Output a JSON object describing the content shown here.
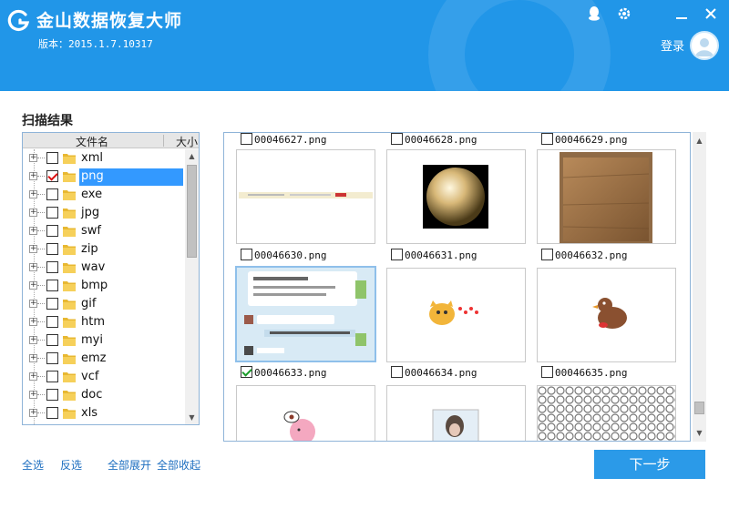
{
  "app": {
    "title": "金山数据恢复大师",
    "version": "版本：2015.1.7.10317",
    "login": "登录",
    "icons": [
      "qq-icon",
      "gear-icon",
      "minimize-icon",
      "close-icon"
    ],
    "accent_color": "#2196e8"
  },
  "scan": {
    "title": "扫描结果",
    "columns": {
      "name": "文件名",
      "size": "大小"
    },
    "items": [
      {
        "label": "xml",
        "checked": false,
        "selected": false
      },
      {
        "label": "png",
        "checked": true,
        "selected": true
      },
      {
        "label": "exe",
        "checked": false,
        "selected": false
      },
      {
        "label": "jpg",
        "checked": false,
        "selected": false
      },
      {
        "label": "swf",
        "checked": false,
        "selected": false
      },
      {
        "label": "zip",
        "checked": false,
        "selected": false
      },
      {
        "label": "wav",
        "checked": false,
        "selected": false
      },
      {
        "label": "bmp",
        "checked": false,
        "selected": false
      },
      {
        "label": "gif",
        "checked": false,
        "selected": false
      },
      {
        "label": "htm",
        "checked": false,
        "selected": false
      },
      {
        "label": "myi",
        "checked": false,
        "selected": false
      },
      {
        "label": "emz",
        "checked": false,
        "selected": false
      },
      {
        "label": "vcf",
        "checked": false,
        "selected": false
      },
      {
        "label": "doc",
        "checked": false,
        "selected": false
      },
      {
        "label": "xls",
        "checked": false,
        "selected": false
      }
    ]
  },
  "files": [
    {
      "name": "00046627.png",
      "checked": false,
      "kind": "caption-only"
    },
    {
      "name": "00046628.png",
      "checked": false,
      "kind": "caption-only"
    },
    {
      "name": "00046629.png",
      "checked": false,
      "kind": "caption-only"
    },
    {
      "name": "00046630.png",
      "checked": false,
      "kind": "banner"
    },
    {
      "name": "00046631.png",
      "checked": false,
      "kind": "sphere"
    },
    {
      "name": "00046632.png",
      "checked": false,
      "kind": "wood-cube"
    },
    {
      "name": "00046633.png",
      "checked": true,
      "kind": "chat-screenshot"
    },
    {
      "name": "00046634.png",
      "checked": false,
      "kind": "cartoon-cat"
    },
    {
      "name": "00046635.png",
      "checked": false,
      "kind": "cartoon-bird"
    }
  ],
  "footer": {
    "select_all": "全选",
    "invert": "反选",
    "expand_all": "全部展开",
    "collapse_all": "全部收起",
    "next": "下一步"
  }
}
